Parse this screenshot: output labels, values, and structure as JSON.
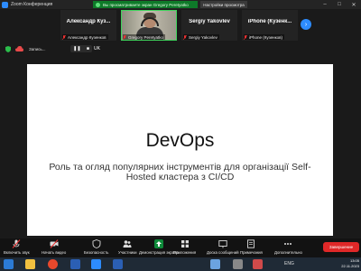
{
  "window": {
    "app_title": "Zoom Конференция",
    "share_banner": "Вы просматриваете экран Gregory Peretyatko",
    "view_settings": "Настройки просмотра",
    "min_glyph": "–",
    "max_glyph": "□",
    "close_glyph": "✕"
  },
  "participants": [
    {
      "display_name": "Александр Куз...",
      "label": "Александр Кузенков"
    },
    {
      "display_name": "",
      "label": "Gregory Peretyatko"
    },
    {
      "display_name": "Sergiy Yakovlev",
      "label": "Sergiy Yakovlev"
    },
    {
      "display_name": "iPhone (Кузенк...",
      "label": "iPhone (Кузенков)"
    }
  ],
  "strip": {
    "next_glyph": "›"
  },
  "recording": {
    "label": "Запись...",
    "pause_glyph": "❚❚",
    "stop_glyph": "■",
    "owner": "UK"
  },
  "slide": {
    "title": "DevOps",
    "subtitle": "Роль та огляд популярних інструментів для організації Self-Hosted кластера з CI/CD"
  },
  "toolbar": {
    "items": [
      {
        "label": "Включить звук",
        "icon": "microphone-muted-icon"
      },
      {
        "label": "Начать видео",
        "icon": "video-off-icon"
      },
      {
        "label": "Безопасность",
        "icon": "shield-icon"
      },
      {
        "label": "Участники",
        "icon": "participants-icon",
        "count": "4"
      },
      {
        "label": "Демонстрация экрана",
        "icon": "share-screen-icon"
      },
      {
        "label": "Приложения",
        "icon": "apps-icon"
      },
      {
        "label": "Доска сообщений",
        "icon": "whiteboard-icon"
      },
      {
        "label": "Примечания",
        "icon": "notes-icon"
      },
      {
        "label": "Дополнительно",
        "icon": "more-icon"
      }
    ],
    "end_label": "Завершение"
  },
  "taskbar": {
    "time": "13:05",
    "date": "22.11.2023",
    "tray_text": "ENG"
  },
  "colors": {
    "accent": "#2d8cff",
    "share_green": "#0e7a29",
    "end_red": "#e02828"
  }
}
